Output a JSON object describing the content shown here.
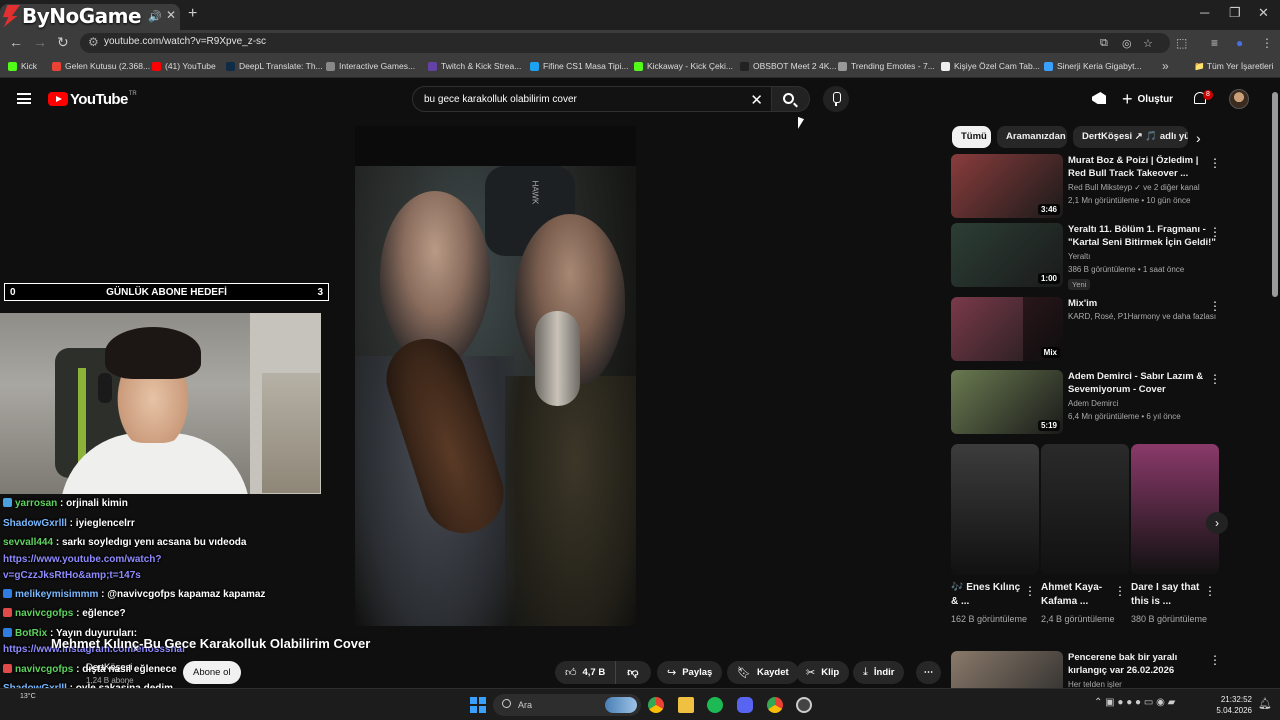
{
  "browser": {
    "logo_text": "ByNoGame",
    "url": "youtube.com/watch?v=R9Xpve_z-sc",
    "bookmarks": [
      {
        "label": "Kick",
        "color": "#53fc18"
      },
      {
        "label": "Gelen Kutusu (2.368...",
        "color": "#ea4335"
      },
      {
        "label": "(41) YouTube",
        "color": "#ff0000"
      },
      {
        "label": "DeepL Translate: Th...",
        "color": "#0f2b46"
      },
      {
        "label": "Interactive Games...",
        "color": "#888888"
      },
      {
        "label": "Twitch & Kick Strea...",
        "color": "#6441a5"
      },
      {
        "label": "Fifine CS1 Masa Tipi...",
        "color": "#1da1f2"
      },
      {
        "label": "Kickaway - Kick Çeki...",
        "color": "#53fc18"
      },
      {
        "label": "OBSBOT Meet 2 4K...",
        "color": "#222222"
      },
      {
        "label": "Trending Emotes - 7...",
        "color": "#999999"
      },
      {
        "label": "Kişiye Özel Cam Tab...",
        "color": "#eeeeee"
      },
      {
        "label": "Sinerji Keria Gigabyt...",
        "color": "#3aa0ff"
      }
    ],
    "all_bookmarks_label": "Tüm Yer İşaretleri"
  },
  "youtube": {
    "logo": "YouTube",
    "country_code": "TR",
    "search_query": "bu gece karakolluk olabilirim cover",
    "create_label": "Oluştur",
    "notification_count": "8"
  },
  "overlay": {
    "goal": {
      "left": "0",
      "label": "GÜNLÜK ABONE HEDEFİ",
      "right": "3"
    },
    "chat": [
      {
        "user": "yarrosan",
        "text": "orjinali kimin",
        "color": "green",
        "badge": "#4aa3df"
      },
      {
        "user": "ShadowGxrlll",
        "text": "iyieglencelrr",
        "color": "blue",
        "badge": ""
      },
      {
        "user": "sevvall444",
        "text": "sarkı soyledıgı yenı acsana bu vıdeoda",
        "color": "green",
        "badge": ""
      },
      {
        "user": "",
        "text": "https://www.youtube.com/watch?",
        "color": "link",
        "badge": ""
      },
      {
        "user": "",
        "text": "v=gCzzJksRtHo&amp;t=147s",
        "color": "link",
        "badge": ""
      },
      {
        "user": "melikeymisimmm",
        "text": "@navivcgofps kapamaz kapamaz",
        "color": "blue",
        "badge": "#2f7de1"
      },
      {
        "user": "navivcgofps",
        "text": "eğlence?",
        "color": "green",
        "badge": "#e24a4a"
      },
      {
        "user": "BotRix",
        "text": "Yayın duyuruları:",
        "color": "green",
        "badge": "#2f7de1"
      },
      {
        "user": "",
        "text": "https://www.instagram.com/enossshal",
        "color": "link",
        "badge": ""
      },
      {
        "user": "navivcgofps",
        "text": "dışta nasıl eğlenece",
        "color": "green",
        "badge": "#e24a4a"
      },
      {
        "user": "ShadowGxrlll",
        "text": "oyle sakasina dedim",
        "color": "blue",
        "badge": ""
      },
      {
        "user": "ShadowGxrlll",
        "text": "",
        "color": "blue",
        "badge": ""
      }
    ]
  },
  "video": {
    "chair_text": "HAWK",
    "title": "Mehmet Kılınç-Bu Gece Karakolluk Olabilirim Cover",
    "channel": "DertKöşesi",
    "subscribers": "1,24 B abone",
    "subscribe_label": "Abone ol",
    "likes": "4,7 B",
    "share_label": "Paylaş",
    "save_label": "Kaydet",
    "clip_label": "Klip",
    "download_label": "İndir"
  },
  "sidebar": {
    "chips": [
      "Tümü",
      "Aramanızdan",
      "DertKöşesi ↗ 🎵 adlı yük"
    ],
    "videos": [
      {
        "title": "Murat Boz & Poizi | Özledim | Red Bull Track Takeover ...",
        "channel": "Red Bull Miksteyp ✓ ve 2 diğer kanal",
        "meta": "2,1 Mn görüntüleme • 10 gün önce",
        "duration": "3:46",
        "thumb": "#8a3c3c",
        "new": ""
      },
      {
        "title": "Yeraltı 11. Bölüm 1. Fragmanı - \"Kartal Seni Bitirmek İçin Geldi!\"",
        "channel": "Yeraltı",
        "meta": "386 B görüntüleme • 1 saat önce",
        "duration": "1:00",
        "thumb": "#2c3e36",
        "new": "Yeni"
      },
      {
        "title": "Mix'im",
        "channel": "KARD, Rosé, P1Harmony ve daha fazlası",
        "meta": "",
        "duration": "Mix",
        "thumb": "#7a3a4a",
        "new": ""
      },
      {
        "title": "Adem Demirci - Sabır Lazım & Sevemiyorum - Cover",
        "channel": "Adem Demirci",
        "meta": "6,4 Mn görüntüleme • 6 yıl önce",
        "duration": "5:19",
        "thumb": "#6a7a50",
        "new": ""
      }
    ],
    "shorts": [
      {
        "title": "🎶 Enes Kılınç & ...",
        "views": "162 B görüntüleme",
        "thumb": "#3c3c3c"
      },
      {
        "title": "Ahmet Kaya-Kafama ...",
        "views": "2,4 B görüntüleme",
        "thumb": "#2a2a2a"
      },
      {
        "title": "Dare I say that this is ...",
        "views": "380 B görüntüleme",
        "thumb": "#8a3a6a"
      }
    ],
    "next_video": {
      "title": "Pencerene bak bir yaralı kırlangıç var 26.02.2026",
      "channel": "Her telden işler",
      "thumb": "#8a7a6a"
    }
  },
  "taskbar": {
    "weather": "13°C",
    "search_placeholder": "Ara",
    "time": "21:32:52",
    "date": "5.04.2026"
  }
}
